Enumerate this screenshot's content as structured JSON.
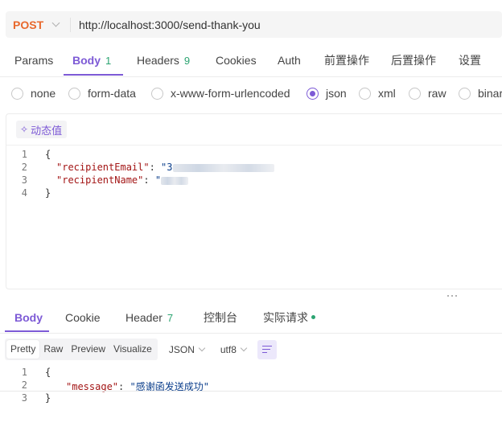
{
  "request": {
    "method": "POST",
    "url": "http://localhost:3000/send-thank-you"
  },
  "request_tabs": [
    {
      "label": "Params",
      "count": ""
    },
    {
      "label": "Body",
      "count": "1"
    },
    {
      "label": "Headers",
      "count": "9"
    },
    {
      "label": "Cookies",
      "count": ""
    },
    {
      "label": "Auth",
      "count": ""
    },
    {
      "label": "前置操作",
      "count": ""
    },
    {
      "label": "后置操作",
      "count": ""
    },
    {
      "label": "设置",
      "count": ""
    }
  ],
  "body_types": [
    "none",
    "form-data",
    "x-www-form-urlencoded",
    "json",
    "xml",
    "raw",
    "binary"
  ],
  "body_type_selected": "json",
  "dynamic_value_label": "动态值",
  "request_body": {
    "line_numbers": [
      "1",
      "2",
      "3",
      "4"
    ],
    "open_brace": "{",
    "close_brace": "}",
    "key1": "\"recipientEmail\"",
    "val1_prefix": "\"3",
    "key2": "\"recipientName\"",
    "val2_prefix": "\"",
    "colon": ": "
  },
  "response_tabs": [
    {
      "label": "Body",
      "count": ""
    },
    {
      "label": "Cookie",
      "count": ""
    },
    {
      "label": "Header",
      "count": "7"
    },
    {
      "label": "控制台",
      "count": ""
    },
    {
      "label": "实际请求",
      "count": ""
    }
  ],
  "response_view_modes": [
    "Pretty",
    "Raw",
    "Preview",
    "Visualize"
  ],
  "response_format": "JSON",
  "response_encoding": "utf8",
  "response_body": {
    "line_numbers": [
      "1",
      "2",
      "3"
    ],
    "open_brace": "{",
    "close_brace": "}",
    "key": "\"message\"",
    "colon": ": ",
    "value": "\"感谢函发送成功\""
  },
  "colors": {
    "accent": "#7d5ad6",
    "method": "#e8682c",
    "count": "#2ba471"
  }
}
